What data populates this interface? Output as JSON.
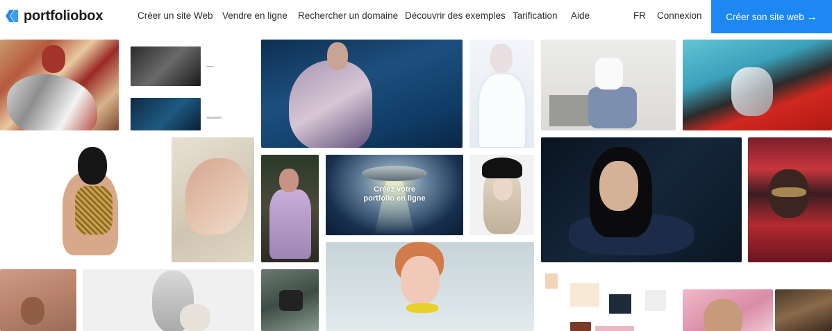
{
  "brand": {
    "name": "portfoliobox",
    "color": "#1e88f2"
  },
  "nav": {
    "items": [
      "Créer un site Web",
      "Vendre en ligne",
      "Rechercher un domaine",
      "Découvrir des exemples",
      "Tarification",
      "Aide"
    ],
    "language": "FR",
    "login": "Connexion",
    "cta": "Créer son site web",
    "cta_arrow": "→"
  },
  "gallery": {
    "promo_line1": "Créez votre",
    "promo_line2": "portfolio en ligne",
    "thumb_caption_a": "сенсо",
    "thumb_caption_b": "TRAVENEEL"
  }
}
